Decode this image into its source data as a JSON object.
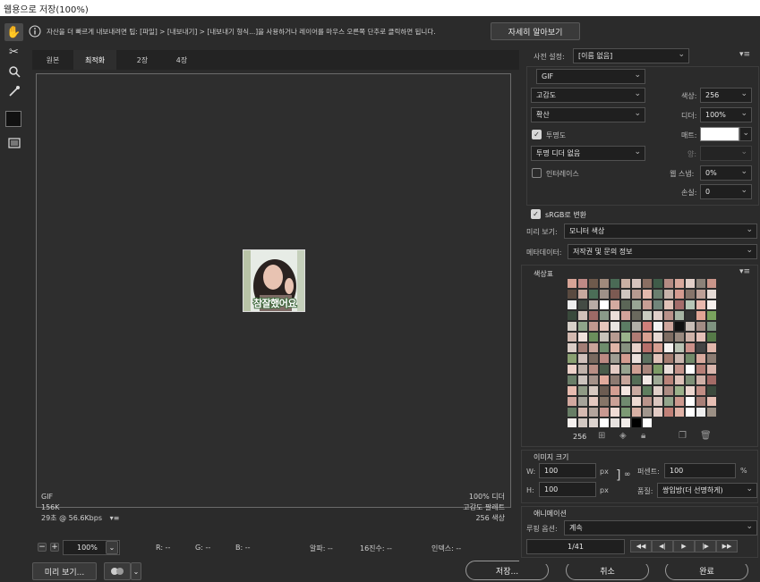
{
  "window": {
    "title": "웹용으로 저장(100%)"
  },
  "tools": {
    "hand": "✋",
    "slice": "✂",
    "zoom": "🔍",
    "eyedropper": "✒",
    "color_swatch": "#111111",
    "preview_toggle": "▭"
  },
  "infobar": {
    "text": "자산을 더 빠르게 내보내려면 팁: [파일] > [내보내기] > [내보내기 형식...]을 사용하거나 레이어를 마우스 오른쪽 단추로 클릭하면 됩니다.",
    "learn_more": "자세히 알아보기"
  },
  "tabs": [
    "원본",
    "최적화",
    "2장",
    "4장"
  ],
  "preview": {
    "caption": "참잘했어요"
  },
  "status_left": {
    "format": "GIF",
    "size": "156K",
    "time": "29초 @ 56.6Kbps",
    "menu": "▾≡"
  },
  "status_right": {
    "dither": "100% 디더",
    "palette": "고감도 팔레트",
    "colors": "256 색상"
  },
  "zoombar": {
    "zoom": "100%",
    "r": "R: --",
    "g": "G: --",
    "b": "B: --",
    "alpha": "알파: --",
    "hex": "16진수: --",
    "index": "인덱스: --"
  },
  "bottom": {
    "preview_btn": "미리 보기...",
    "save": "저장...",
    "cancel": "취소",
    "done": "완료"
  },
  "settings": {
    "preset_label": "사전 설정:",
    "preset_value": "[이름 없음]",
    "format": "GIF",
    "reduction": "고감도",
    "dither_algo": "확산",
    "colors_label": "색상:",
    "colors_value": "256",
    "dither_label": "디더:",
    "dither_value": "100%",
    "transparency_label": "투명도",
    "matte_label": "매트:",
    "trans_dither": "투명 디더 없음",
    "amount_label": "양:",
    "interlace_label": "인터레이스",
    "websnap_label": "웹 스냅:",
    "websnap_value": "0%",
    "lossy_label": "손실:",
    "lossy_value": "0",
    "srgb_label": "sRGB로 변환",
    "preview_label": "미리 보기:",
    "preview_value": "모니터 색상",
    "metadata_label": "메타데이터:",
    "metadata_value": "저작권 및 문의 정보"
  },
  "color_table": {
    "title": "색상표",
    "count": "256",
    "swatches": [
      "#d7a497",
      "#bf8a86",
      "#6e5a4c",
      "#a08a7c",
      "#4a6a55",
      "#c9b0a4",
      "#d6c4be",
      "#8a6e62",
      "#3f5c49",
      "#b58c84",
      "#d8a89c",
      "#e2cfc8",
      "#8b8178",
      "#c9958a",
      "#5a4a40",
      "#c8a89e",
      "#4b6e57",
      "#9e9188",
      "#7c5a52",
      "#cfc6c0",
      "#b79a90",
      "#e3b9ad",
      "#6b7f6f",
      "#c7b3aa",
      "#d49b90",
      "#86746a",
      "#bda097",
      "#e6dcd7",
      "#eeeeee",
      "#444b44",
      "#b8aca5",
      "#ffffff",
      "#d3aaa0",
      "#5b6657",
      "#99a595",
      "#c79e95",
      "#71857a",
      "#e1c2b8",
      "#a46d6b",
      "#b7c6b6",
      "#e8b9ae",
      "#f6f0ed",
      "#3a4a3c",
      "#d1c1b9",
      "#9d6a66",
      "#8a9a89",
      "#eaded9",
      "#d2a39b",
      "#6a695e",
      "#c8cbc0",
      "#dfcfc9",
      "#b99189",
      "#a7b5a4",
      "#333333",
      "#e0a595",
      "#7aa35e",
      "#d7d0c9",
      "#8fa58a",
      "#c09a90",
      "#e7c6bc",
      "#e8e5e1",
      "#5c7d64",
      "#b2b0a8",
      "#cf7f7a",
      "#f3f3f3",
      "#cea69d",
      "#111111",
      "#c8bdb6",
      "#a28c84",
      "#7f9380",
      "#d3b9b0",
      "#f0e1dc",
      "#6b8f5c",
      "#c6c2b9",
      "#b79b91",
      "#9ab48c",
      "#b07c75",
      "#d9a191",
      "#e6d8d2",
      "#7f6d63",
      "#99897f",
      "#ceb2a8",
      "#e4c0b7",
      "#567a48",
      "#dbcdc6",
      "#a37e76",
      "#c9a49a",
      "#6e8d6d",
      "#deb4a7",
      "#86917f",
      "#e8d1ca",
      "#b66f6a",
      "#d79f92",
      "#f7f3f1",
      "#b9c2b3",
      "#cb918a",
      "#444444",
      "#e2b8ac",
      "#8aa071",
      "#cfc0ba",
      "#7a6a60",
      "#bb8a83",
      "#9f9d93",
      "#d39c90",
      "#eadfdb",
      "#5d7160",
      "#e0c2b9",
      "#a47c70",
      "#cbb7af",
      "#728b6a",
      "#d9aa9e",
      "#8c7c72",
      "#edd1c9",
      "#c0b2aa",
      "#b98e85",
      "#4a5b4a",
      "#e4cbc4",
      "#97a38f",
      "#d0a094",
      "#a9867c",
      "#7d9b66",
      "#e9ded9",
      "#c3938a",
      "#ffffff",
      "#b67f77",
      "#dbb7ae",
      "#6a7e68",
      "#ccc3bd",
      "#a5928a",
      "#e1aa9c",
      "#8d7a71",
      "#c7a59b",
      "#556e57",
      "#f1e8e4",
      "#9eaa96",
      "#b98379",
      "#dec1b8",
      "#7e9077",
      "#cfb0a7",
      "#a46c67",
      "#e8bcb0",
      "#8f9a85",
      "#d7c9c2",
      "#6c5c52",
      "#d49e92",
      "#f4e6e1",
      "#c9aaa1",
      "#5f7e5f",
      "#e0d0c9",
      "#ad8c83",
      "#9bb08a",
      "#ecd6cf",
      "#c08d84",
      "#3c4a3d",
      "#d2a89f",
      "#a6a39a",
      "#e5c9c1",
      "#867568",
      "#cba197",
      "#708a6f",
      "#eedad3",
      "#b9948b",
      "#dac6bf",
      "#93a58c",
      "#cd998e",
      "#ffffff",
      "#a87f77",
      "#e7bfb4",
      "#677d65",
      "#d6bab1",
      "#b4a59d",
      "#c89991",
      "#f0dcd5",
      "#7d9a74",
      "#d8b0a5",
      "#a1968d",
      "#e3ccc5",
      "#c18178",
      "#e0b2a6",
      "#ffffff",
      "#eeeeee",
      "#9c9085",
      "#f5f0ee",
      "#d2c8c2",
      "#ddd4cf",
      "#ffffff",
      "#e7e2df",
      "#f2ece9",
      "#000000",
      "#ffffff"
    ],
    "icons": [
      "map-icon",
      "web-safe-icon",
      "lock-icon",
      "new-color-icon",
      "delete-icon"
    ]
  },
  "image_size": {
    "title": "이미지 크기",
    "w_label": "W:",
    "w_value": "100",
    "h_label": "H:",
    "h_value": "100",
    "unit": "px",
    "percent_label": "퍼센트:",
    "percent_value": "100",
    "percent_unit": "%",
    "quality_label": "품질:",
    "quality_value": "쌍입방(더 선명하게)"
  },
  "animation": {
    "title": "애니메이션",
    "loop_label": "루핑 옵션:",
    "loop_value": "계속",
    "frame": "1/41"
  },
  "colors": {
    "accent": "#2b2b2b",
    "panel": "#2b2b2b",
    "field": "#1f1f1f"
  }
}
